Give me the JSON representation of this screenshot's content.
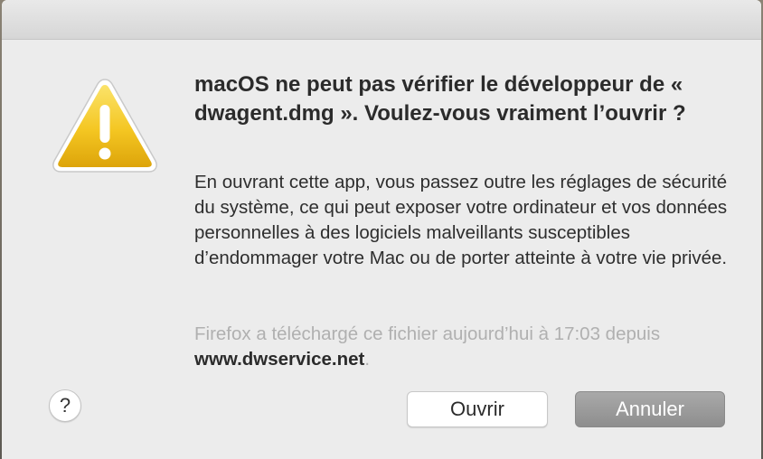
{
  "dialog": {
    "headline": "macOS ne peut pas vérifier le développeur de « dwagent.dmg ». Voulez-vous vraiment l’ouvrir ?",
    "body": "En ouvrant cette app, vous passez outre les réglages de sécurité du système, ce qui peut exposer votre ordinateur et vos données personnelles à des logiciels malveillants susceptibles d’endommager votre Mac ou de porter atteinte à votre vie privée.",
    "source_text": "Firefox a téléchargé ce fichier aujourd’hui à 17:03 depuis",
    "source_url": "www.dwservice.net",
    "source_period": ".",
    "icon": "warning-icon",
    "help_label": "?",
    "open_label": "Ouvrir",
    "cancel_label": "Annuler"
  },
  "colors": {
    "dialog_background": "#ececec",
    "warning_yellow": "#f1c21f",
    "cancel_button": "#9b9b9b"
  }
}
